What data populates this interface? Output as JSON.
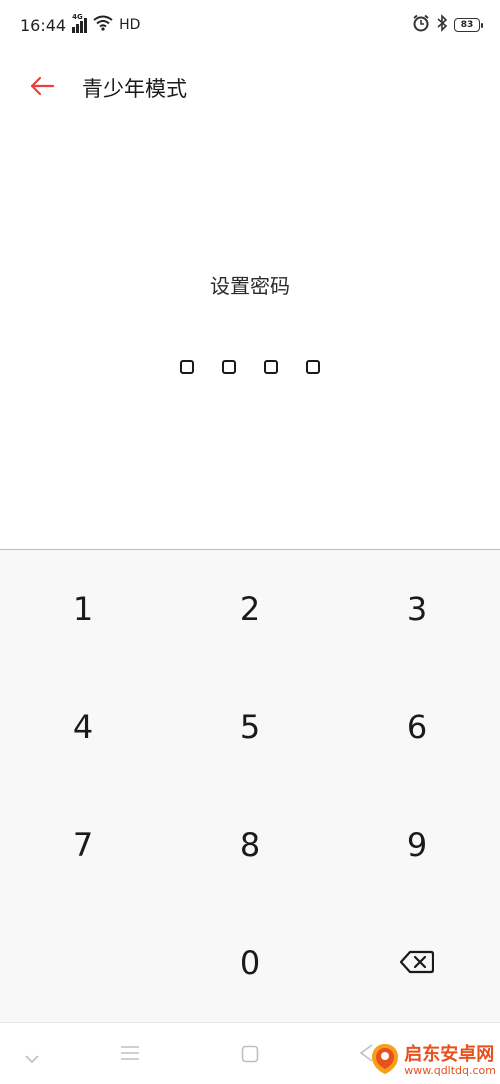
{
  "status_bar": {
    "time": "16:44",
    "network": "4G",
    "hd": "HD",
    "battery": "83"
  },
  "header": {
    "title": "青少年模式"
  },
  "password": {
    "label": "设置密码",
    "length": 4
  },
  "keypad": {
    "keys": [
      "1",
      "2",
      "3",
      "4",
      "5",
      "6",
      "7",
      "8",
      "9",
      "",
      "0",
      "⌫"
    ]
  },
  "watermark": {
    "name": "启东安卓网",
    "url": "www.qdltdq.com"
  },
  "colors": {
    "accent": "#e8413c",
    "keypad_bg": "#f8f8f8",
    "watermark": "#e8501e"
  }
}
